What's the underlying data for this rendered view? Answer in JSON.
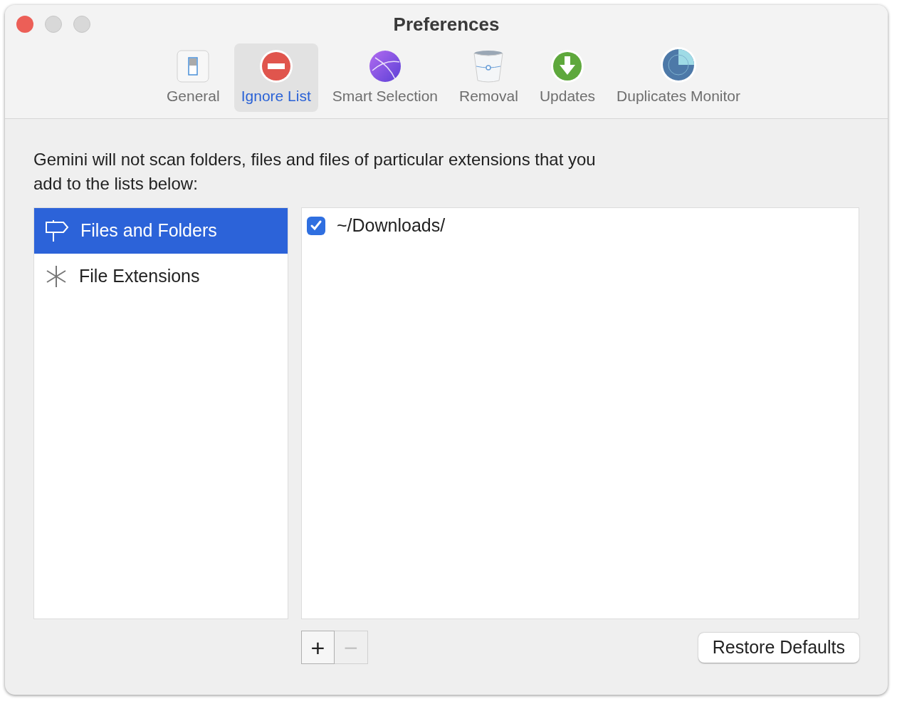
{
  "window": {
    "title": "Preferences"
  },
  "tabs": [
    {
      "label": "General",
      "kind": "switch",
      "selected": false
    },
    {
      "label": "Ignore List",
      "kind": "stop",
      "selected": true
    },
    {
      "label": "Smart Selection",
      "kind": "sphere",
      "selected": false
    },
    {
      "label": "Removal",
      "kind": "bin",
      "selected": false
    },
    {
      "label": "Updates",
      "kind": "download",
      "selected": false
    },
    {
      "label": "Duplicates Monitor",
      "kind": "radar",
      "selected": false
    }
  ],
  "description": "Gemini will not scan folders, files and files of particular extensions that you add to the lists below:",
  "sidebar": {
    "items": [
      {
        "label": "Files and Folders",
        "kind": "signpost",
        "selected": true
      },
      {
        "label": "File Extensions",
        "kind": "asterisk",
        "selected": false
      }
    ]
  },
  "list": {
    "rows": [
      {
        "path": "~/Downloads/",
        "checked": true
      }
    ]
  },
  "buttons": {
    "add": {
      "label": "+",
      "disabled": false
    },
    "remove": {
      "label": "−",
      "disabled": true
    },
    "restore": "Restore Defaults"
  }
}
